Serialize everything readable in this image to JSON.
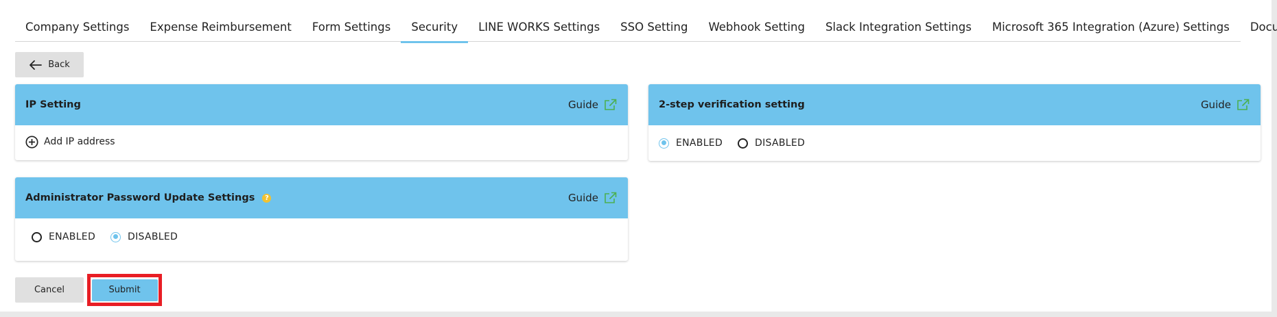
{
  "tabs": [
    {
      "label": "Company Settings",
      "active": false
    },
    {
      "label": "Expense Reimbursement",
      "active": false
    },
    {
      "label": "Form Settings",
      "active": false
    },
    {
      "label": "Security",
      "active": true
    },
    {
      "label": "LINE WORKS Settings",
      "active": false
    },
    {
      "label": "SSO Setting",
      "active": false
    },
    {
      "label": "Webhook Setting",
      "active": false
    },
    {
      "label": "Slack Integration Settings",
      "active": false
    },
    {
      "label": "Microsoft 365 Integration (Azure) Settings",
      "active": false
    },
    {
      "label": "DocuSign",
      "active": false
    }
  ],
  "back_label": "Back",
  "guide_label": "Guide",
  "ip_setting": {
    "title": "IP Setting",
    "add_label": "Add IP address"
  },
  "two_step": {
    "title": "2-step verification setting",
    "enabled_label": "ENABLED",
    "disabled_label": "DISABLED",
    "selected": "ENABLED"
  },
  "admin_password": {
    "title": "Administrator Password Update Settings",
    "help_glyph": "?",
    "enabled_label": "ENABLED",
    "disabled_label": "DISABLED",
    "selected": "DISABLED"
  },
  "footer": {
    "cancel_label": "Cancel",
    "submit_label": "Submit"
  },
  "colors": {
    "accent": "#6fc3ec",
    "highlight": "#e81e25",
    "help": "#f2c230",
    "guide_icon": "#4caf50"
  }
}
